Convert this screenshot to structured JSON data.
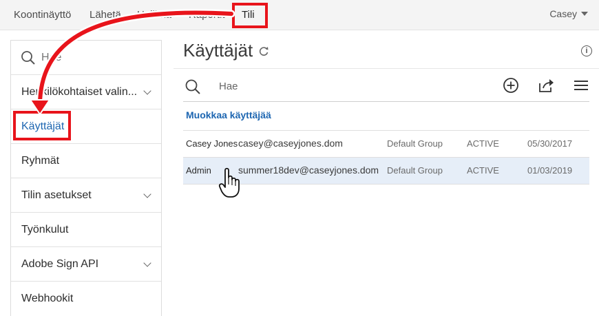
{
  "nav": {
    "items": [
      "Koontinäyttö",
      "Lähetä",
      "Hallinta",
      "Raportit",
      "Tili"
    ],
    "active": "Tili",
    "user": "Casey"
  },
  "sidebar": {
    "search_placeholder": "Hae",
    "items": [
      {
        "label": "Henkilökohtaiset valin...",
        "expandable": true
      },
      {
        "label": "Käyttäjät",
        "expandable": false,
        "active": true
      },
      {
        "label": "Ryhmät",
        "expandable": false
      },
      {
        "label": "Tilin asetukset",
        "expandable": true
      },
      {
        "label": "Työnkulut",
        "expandable": false
      },
      {
        "label": "Adobe Sign API",
        "expandable": true
      },
      {
        "label": "Webhookit",
        "expandable": false
      }
    ]
  },
  "main": {
    "title": "Käyttäjät",
    "search_placeholder": "Hae",
    "edit_link": "Muokkaa käyttäjää",
    "users": [
      {
        "name": "Casey Jones",
        "email": "casey@caseyjones.dom",
        "group": "Default Group",
        "status": "ACTIVE",
        "date": "05/30/2017",
        "selected": false
      },
      {
        "name": "Admin",
        "email": "summer18dev@caseyjones.dom",
        "group": "Default Group",
        "status": "ACTIVE",
        "date": "01/03/2019",
        "selected": true
      }
    ]
  },
  "colors": {
    "highlight": "#e8141b",
    "link": "#1d66b1",
    "selected_row": "#e6eef8"
  },
  "icons": [
    "search-icon",
    "refresh-icon",
    "info-icon",
    "add-icon",
    "export-icon",
    "menu-icon",
    "chevron-down-icon",
    "hand-cursor-icon",
    "arrow-annotation"
  ]
}
